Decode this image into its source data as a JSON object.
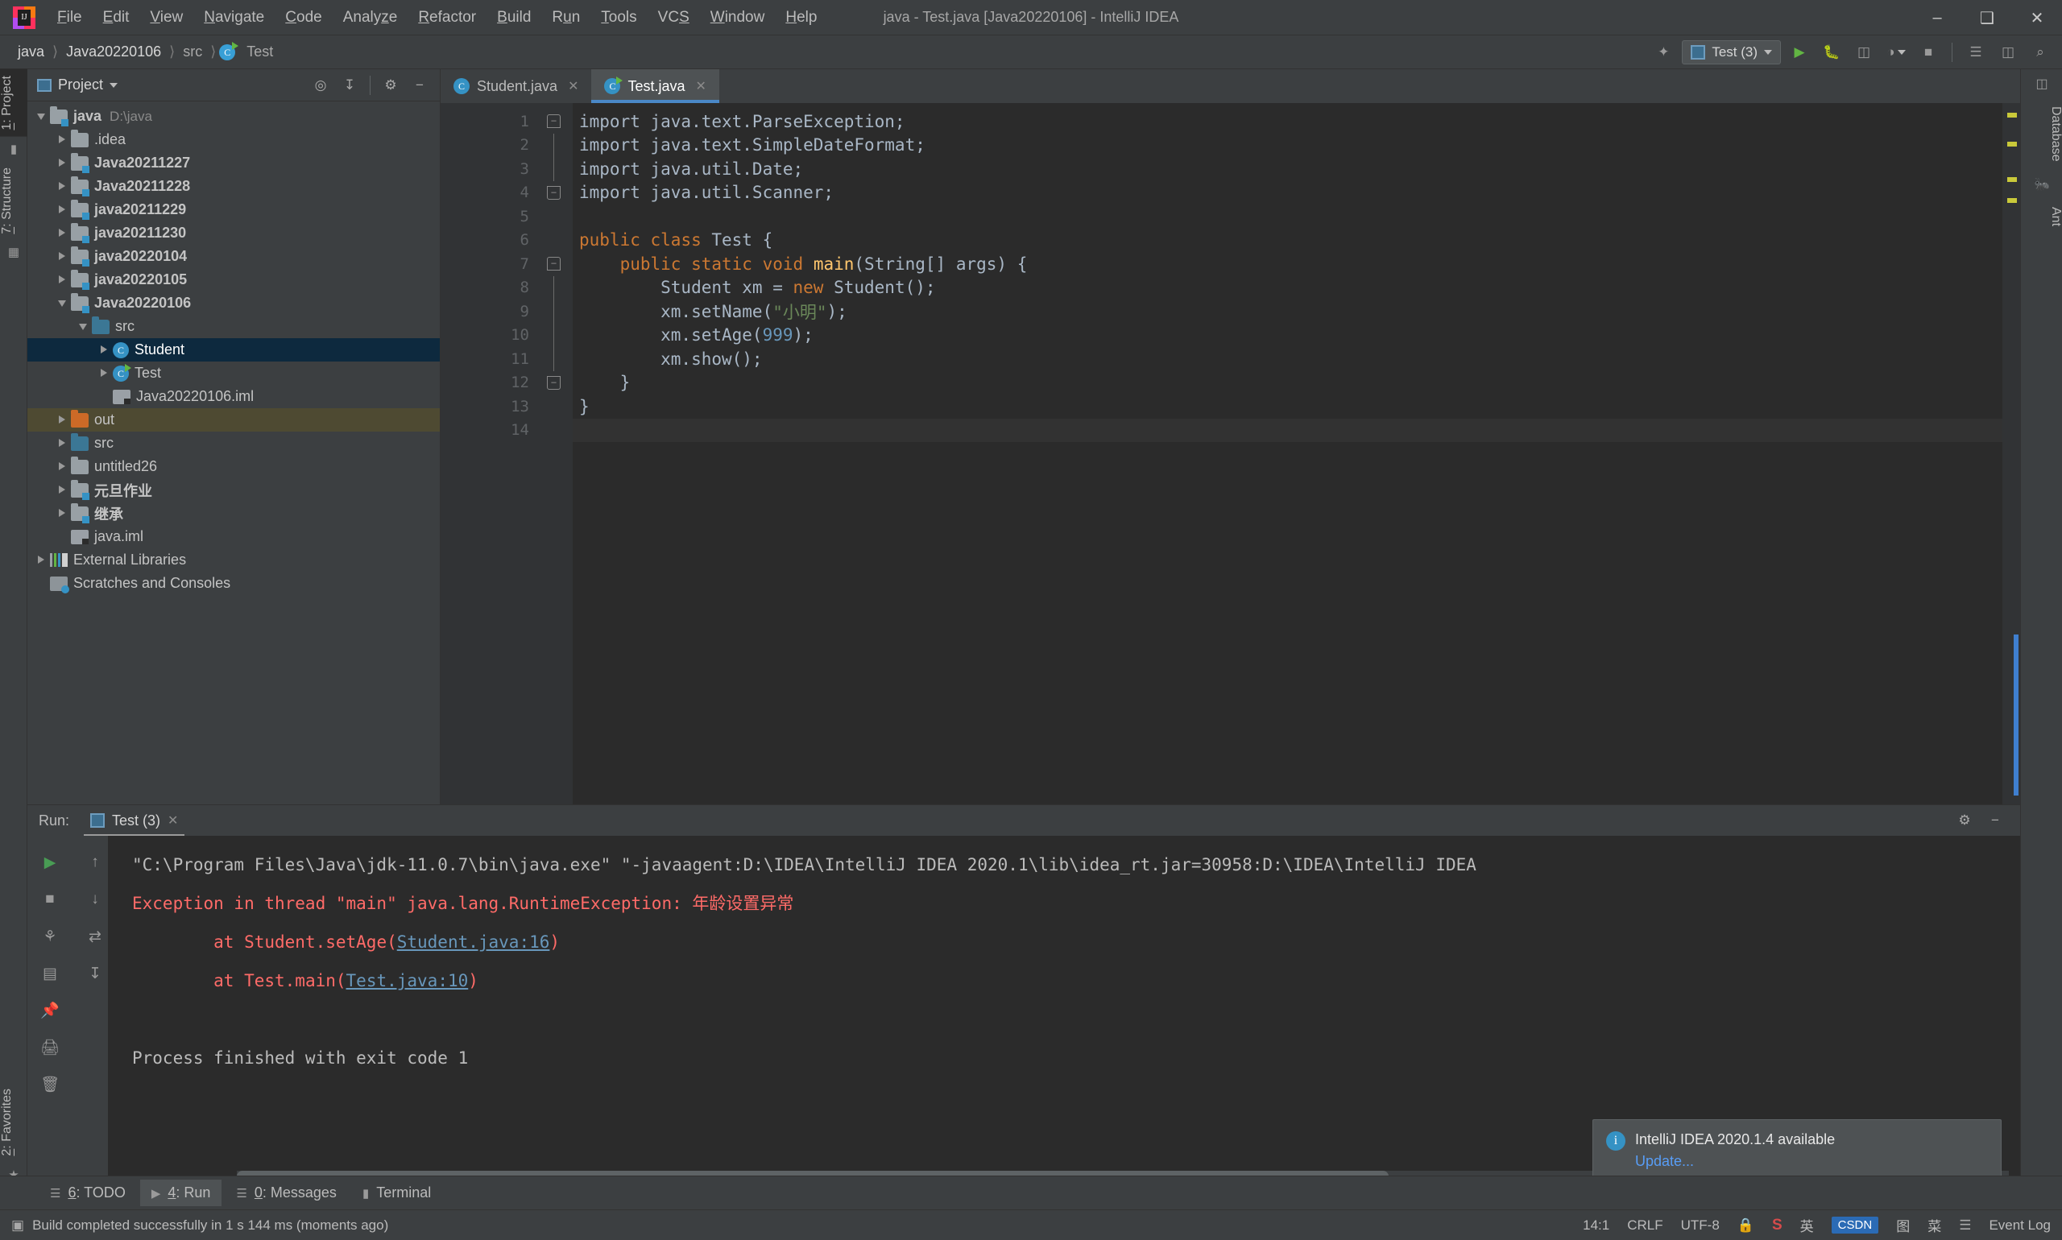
{
  "window": {
    "title": "java - Test.java [Java20220106] - IntelliJ IDEA",
    "minimize": "–",
    "maximize": "❑",
    "close": "✕"
  },
  "menubar": [
    {
      "label": "File"
    },
    {
      "label": "Edit"
    },
    {
      "label": "View"
    },
    {
      "label": "Navigate"
    },
    {
      "label": "Code"
    },
    {
      "label": "Analyze"
    },
    {
      "label": "Refactor"
    },
    {
      "label": "Build"
    },
    {
      "label": "Run"
    },
    {
      "label": "Tools"
    },
    {
      "label": "VCS"
    },
    {
      "label": "Window"
    },
    {
      "label": "Help"
    }
  ],
  "breadcrumb": {
    "items": [
      "java",
      "Java20220106",
      "src",
      "Test"
    ],
    "separator": "〉"
  },
  "navbar_right": {
    "search_icon": "search-everywhere-icon",
    "run_config": "Test (3)",
    "run_icon": "▶",
    "debug_icon": "debug-icon",
    "coverage_icon": "coverage-icon",
    "profile_icon": "profiler-icon",
    "stop_icon": "■",
    "updates_icon": "updates-icon",
    "layout_icon": "layout-icon",
    "magnifier_icon": "⌕"
  },
  "left_strip": {
    "project_tab": "1: Project",
    "structure_tab": "7: Structure",
    "favorites_tab": "2: Favorites"
  },
  "right_strip": {
    "database_tab": "Database",
    "ant_tab": "Ant"
  },
  "project_panel": {
    "title": "Project",
    "actions": [
      "locate-icon",
      "collapse-all-icon",
      "settings-gear-icon",
      "hide-icon"
    ],
    "tree": [
      {
        "label": "java",
        "path": "D:\\java",
        "icon": "folder-module",
        "indent": 0,
        "expanded": true,
        "bold": true
      },
      {
        "label": ".idea",
        "icon": "folder",
        "indent": 1,
        "expanded": false
      },
      {
        "label": "Java20211227",
        "icon": "folder-module",
        "indent": 1,
        "expanded": false,
        "bold": true
      },
      {
        "label": "Java20211228",
        "icon": "folder-module",
        "indent": 1,
        "expanded": false,
        "bold": true
      },
      {
        "label": "java20211229",
        "icon": "folder-module",
        "indent": 1,
        "expanded": false,
        "bold": true
      },
      {
        "label": "java20211230",
        "icon": "folder-module",
        "indent": 1,
        "expanded": false,
        "bold": true
      },
      {
        "label": "java20220104",
        "icon": "folder-module",
        "indent": 1,
        "expanded": false,
        "bold": true
      },
      {
        "label": "java20220105",
        "icon": "folder-module",
        "indent": 1,
        "expanded": false,
        "bold": true
      },
      {
        "label": "Java20220106",
        "icon": "folder-module",
        "indent": 1,
        "expanded": true,
        "bold": true
      },
      {
        "label": "src",
        "icon": "folder-source",
        "indent": 2,
        "expanded": true
      },
      {
        "label": "Student",
        "icon": "java-class",
        "indent": 3,
        "expanded": false,
        "selected": true
      },
      {
        "label": "Test",
        "icon": "java-class-runnable",
        "indent": 3,
        "expanded": false
      },
      {
        "label": "Java20220106.iml",
        "icon": "iml-file",
        "indent": 3,
        "leaf": true
      },
      {
        "label": "out",
        "icon": "folder-excluded",
        "indent": 1,
        "expanded": false,
        "highlight": true
      },
      {
        "label": "src",
        "icon": "folder-source",
        "indent": 1,
        "expanded": false
      },
      {
        "label": "untitled26",
        "icon": "folder",
        "indent": 1,
        "expanded": false
      },
      {
        "label": "元旦作业",
        "icon": "folder-module",
        "indent": 1,
        "expanded": false,
        "bold": true
      },
      {
        "label": "继承",
        "icon": "folder-module",
        "indent": 1,
        "expanded": false,
        "bold": true
      },
      {
        "label": "java.iml",
        "icon": "iml-file",
        "indent": 1,
        "leaf": true
      },
      {
        "label": "External Libraries",
        "icon": "library",
        "indent": 0,
        "expanded": false
      },
      {
        "label": "Scratches and Consoles",
        "icon": "scratches",
        "indent": 0,
        "leaf": true
      }
    ]
  },
  "editor": {
    "tabs": [
      {
        "label": "Student.java",
        "icon": "java-class",
        "active": false,
        "close": "✕"
      },
      {
        "label": "Test.java",
        "icon": "java-class-runnable",
        "active": true,
        "close": "✕"
      }
    ],
    "lines": [
      {
        "n": 1,
        "runnable": false,
        "fold": "top",
        "tokens": [
          {
            "t": "import java.text.ParseException;",
            "c": "plain"
          }
        ]
      },
      {
        "n": 2,
        "runnable": false,
        "fold": "mid",
        "tokens": [
          {
            "t": "import java.text.SimpleDateFormat;",
            "c": "plain"
          }
        ]
      },
      {
        "n": 3,
        "runnable": false,
        "fold": "mid",
        "tokens": [
          {
            "t": "import java.util.Date;",
            "c": "plain"
          }
        ]
      },
      {
        "n": 4,
        "runnable": false,
        "fold": "bot",
        "tokens": [
          {
            "t": "import java.util.Scanner;",
            "c": "plain"
          }
        ]
      },
      {
        "n": 5,
        "runnable": false,
        "fold": "",
        "tokens": []
      },
      {
        "n": 6,
        "runnable": true,
        "fold": "",
        "tokens": [
          {
            "t": "public ",
            "c": "kw"
          },
          {
            "t": "class ",
            "c": "kw"
          },
          {
            "t": "Test ",
            "c": "plain"
          },
          {
            "t": "{",
            "c": "plain"
          }
        ]
      },
      {
        "n": 7,
        "runnable": true,
        "fold": "top",
        "tokens": [
          {
            "t": "    ",
            "c": "plain"
          },
          {
            "t": "public ",
            "c": "kw"
          },
          {
            "t": "static ",
            "c": "kw"
          },
          {
            "t": "void ",
            "c": "kw"
          },
          {
            "t": "main",
            "c": "meth"
          },
          {
            "t": "(String[] args) {",
            "c": "plain"
          }
        ]
      },
      {
        "n": 8,
        "runnable": false,
        "fold": "mid",
        "tokens": [
          {
            "t": "        Student xm = ",
            "c": "plain"
          },
          {
            "t": "new ",
            "c": "kw"
          },
          {
            "t": "Student();",
            "c": "plain"
          }
        ]
      },
      {
        "n": 9,
        "runnable": false,
        "fold": "mid",
        "tokens": [
          {
            "t": "        xm.setName(",
            "c": "plain"
          },
          {
            "t": "\"小明\"",
            "c": "str"
          },
          {
            "t": ");",
            "c": "plain"
          }
        ]
      },
      {
        "n": 10,
        "runnable": false,
        "fold": "mid",
        "tokens": [
          {
            "t": "        xm.setAge(",
            "c": "plain"
          },
          {
            "t": "999",
            "c": "num"
          },
          {
            "t": ");",
            "c": "plain"
          }
        ]
      },
      {
        "n": 11,
        "runnable": false,
        "fold": "mid",
        "tokens": [
          {
            "t": "        xm.show();",
            "c": "plain"
          }
        ]
      },
      {
        "n": 12,
        "runnable": false,
        "fold": "bot",
        "tokens": [
          {
            "t": "    }",
            "c": "plain"
          }
        ]
      },
      {
        "n": 13,
        "runnable": false,
        "fold": "",
        "tokens": [
          {
            "t": "}",
            "c": "plain"
          }
        ]
      },
      {
        "n": 14,
        "runnable": false,
        "fold": "",
        "tokens": [],
        "current": true
      }
    ]
  },
  "run_panel": {
    "label": "Run:",
    "tab": "Test (3)",
    "tab_close": "✕",
    "header_actions": [
      "settings-gear-icon",
      "hide-icon"
    ],
    "toolbar": [
      "rerun-icon",
      "stop-icon",
      "dump-threads-icon",
      "restore-layout-icon",
      "pin-icon",
      "print-icon",
      "trash-icon"
    ],
    "scroll_icons": [
      "scroll-up-icon",
      "scroll-down-icon",
      "soft-wrap-icon",
      "scroll-to-end-icon"
    ],
    "console": [
      {
        "type": "plain",
        "text": "\"C:\\Program Files\\Java\\jdk-11.0.7\\bin\\java.exe\" \"-javaagent:D:\\IDEA\\IntelliJ IDEA 2020.1\\lib\\idea_rt.jar=30958:D:\\IDEA\\IntelliJ IDEA"
      },
      {
        "type": "error",
        "text": "Exception in thread \"main\" java.lang.RuntimeException: ",
        "cn": "年龄设置异常"
      },
      {
        "type": "stack",
        "prefix": "\tat Student.setAge(",
        "link": "Student.java:16",
        "suffix": ")"
      },
      {
        "type": "stack",
        "prefix": "\tat Test.main(",
        "link": "Test.java:10",
        "suffix": ")"
      },
      {
        "type": "blank",
        "text": ""
      },
      {
        "type": "plain",
        "text": "Process finished with exit code 1"
      }
    ]
  },
  "notification": {
    "icon": "info-icon",
    "title": "IntelliJ IDEA 2020.1.4 available",
    "link": "Update..."
  },
  "bottom_bar": {
    "tabs": [
      {
        "label": "6: TODO",
        "icon": "todo-icon",
        "active": false
      },
      {
        "label": "4: Run",
        "icon": "run-icon",
        "active": true
      },
      {
        "label": "0: Messages",
        "icon": "messages-icon",
        "active": false
      },
      {
        "label": "Terminal",
        "icon": "terminal-icon",
        "active": false
      }
    ]
  },
  "status_bar": {
    "message": "Build completed successfully in 1 s 144 ms (moments ago)",
    "caret": "14:1",
    "line_sep": "CRLF",
    "encoding": "UTF-8",
    "lock_icon": "lock-icon",
    "branch_icon": "branch-icon",
    "tray": [
      "S",
      "英",
      "CSDN",
      "图",
      "菜"
    ],
    "event_log": "Event Log"
  },
  "colors": {
    "accent": "#4a88c7",
    "keyword": "#cc7832",
    "string": "#6a8759",
    "number": "#6897bb",
    "method": "#ffc66d",
    "error": "#ff6b68",
    "link": "#6897bb",
    "selection": "#0d293e",
    "excluded": "#4e4a32"
  }
}
